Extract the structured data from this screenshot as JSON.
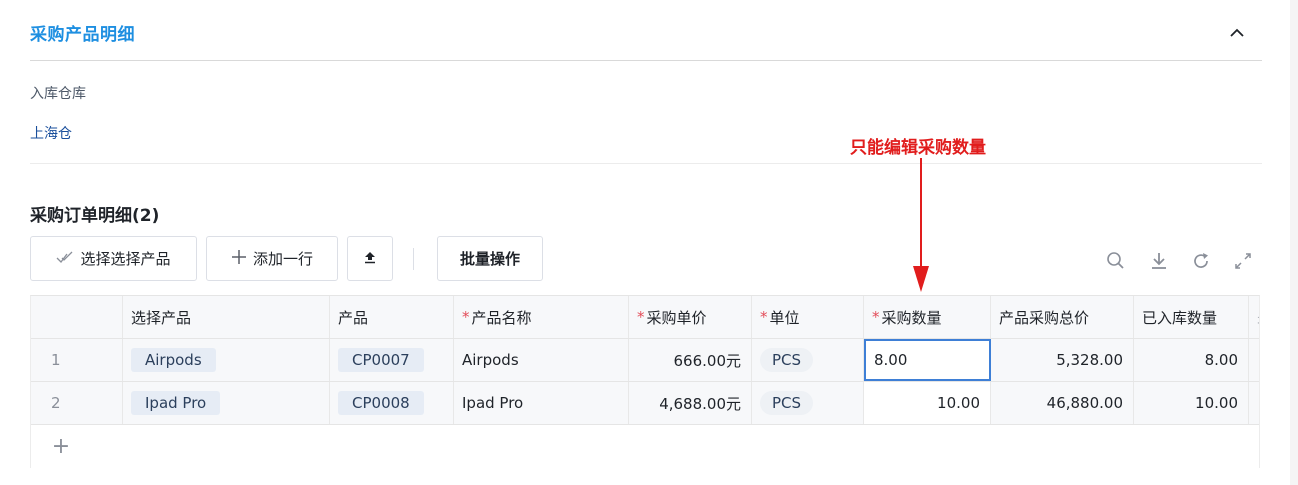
{
  "section": {
    "title": "采购产品明细"
  },
  "warehouse": {
    "label": "入库仓库",
    "value": "上海仓"
  },
  "annotation": {
    "text": "只能编辑采购数量"
  },
  "order": {
    "title": "采购订单明细(2)"
  },
  "toolbar": {
    "select_label": "选择选择产品",
    "add_label": "添加一行",
    "batch_label": "批量操作"
  },
  "table": {
    "headers": {
      "select_product": "选择产品",
      "product": "产品",
      "product_name": "产品名称",
      "unit_price": "采购单价",
      "unit": "单位",
      "quantity": "采购数量",
      "total_price": "产品采购总价",
      "stocked_qty": "已入库数量",
      "more": "未"
    },
    "required_mark": "*",
    "rows": [
      {
        "index": "1",
        "select_product": "Airpods",
        "product": "CP0007",
        "product_name": "Airpods",
        "unit_price": "666.00元",
        "unit": "PCS",
        "quantity": "8.00",
        "total_price": "5,328.00",
        "stocked_qty": "8.00"
      },
      {
        "index": "2",
        "select_product": "Ipad Pro",
        "product": "CP0008",
        "product_name": "Ipad Pro",
        "unit_price": "4,688.00元",
        "unit": "PCS",
        "quantity": "10.00",
        "total_price": "46,880.00",
        "stocked_qty": "10.00"
      }
    ],
    "add_row_symbol": "+"
  },
  "icons": {
    "collapse": "chevron-up-icon",
    "select": "double-check-icon",
    "add": "plus-icon",
    "upload": "upload-icon",
    "search": "search-icon",
    "download": "download-icon",
    "refresh": "refresh-icon",
    "fullscreen": "expand-icon"
  },
  "colors": {
    "accent": "#1e8fe1",
    "annotation": "#e11d1d",
    "required": "#e34d59",
    "active_border": "#3e7fd6"
  }
}
